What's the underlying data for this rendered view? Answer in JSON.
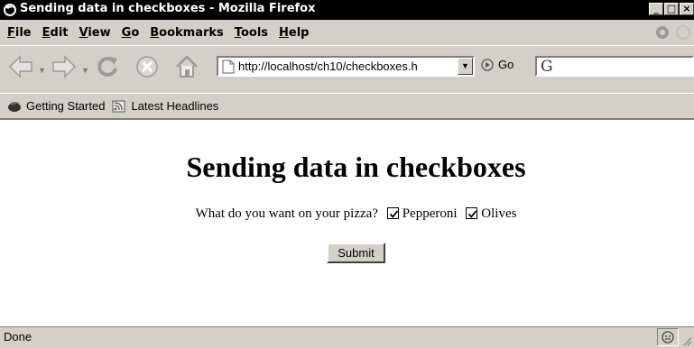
{
  "window": {
    "title": "Sending data in checkboxes - Mozilla Firefox",
    "controls": [
      "_",
      "□",
      "×"
    ]
  },
  "menubar": {
    "items": [
      {
        "first": "F",
        "rest": "ile"
      },
      {
        "first": "E",
        "rest": "dit"
      },
      {
        "first": "V",
        "rest": "iew"
      },
      {
        "first": "G",
        "rest": "o"
      },
      {
        "first": "B",
        "rest": "ookmarks"
      },
      {
        "first": "T",
        "rest": "ools"
      },
      {
        "first": "H",
        "rest": "elp"
      }
    ]
  },
  "navbar": {
    "url": "http://localhost/ch10/checkboxes.h",
    "go_label": "Go",
    "search_value": ""
  },
  "bookmarks": {
    "items": [
      "Getting Started",
      "Latest Headlines"
    ]
  },
  "page": {
    "heading": "Sending data in checkboxes",
    "question": "What do you want on your pizza?",
    "options": [
      {
        "label": "Pepperoni",
        "checked": true
      },
      {
        "label": "Olives",
        "checked": true
      }
    ],
    "submit_label": "Submit"
  },
  "status": {
    "text": "Done"
  },
  "colors": {
    "chrome": "#d4d0c8",
    "titlebar": "#000000",
    "content": "#ffffff"
  }
}
